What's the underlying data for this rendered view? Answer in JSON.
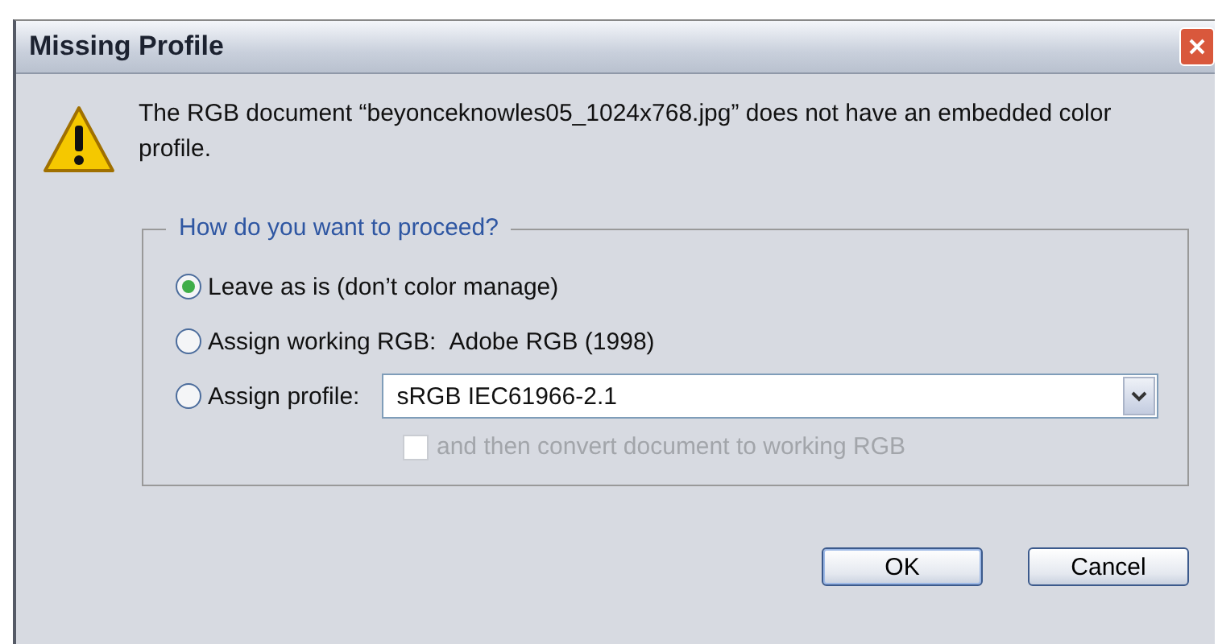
{
  "window": {
    "title": "Missing Profile"
  },
  "message": "The RGB document “beyonceknowles05_1024x768.jpg” does not have an embedded color profile.",
  "group": {
    "legend": "How do you want to proceed?",
    "options": [
      {
        "kind": "plain",
        "label": "Leave as is (don’t color manage)",
        "selected": true
      },
      {
        "kind": "value",
        "label": "Assign working RGB:",
        "value": "Adobe RGB (1998)",
        "selected": false
      },
      {
        "kind": "dropdown",
        "label": "Assign profile:",
        "value": "sRGB IEC61966-2.1",
        "selected": false
      }
    ],
    "checkbox": {
      "label": "and then convert document to working RGB",
      "checked": false,
      "disabled": true
    }
  },
  "buttons": [
    {
      "label": "OK",
      "default": true
    },
    {
      "label": "Cancel",
      "default": false
    }
  ]
}
